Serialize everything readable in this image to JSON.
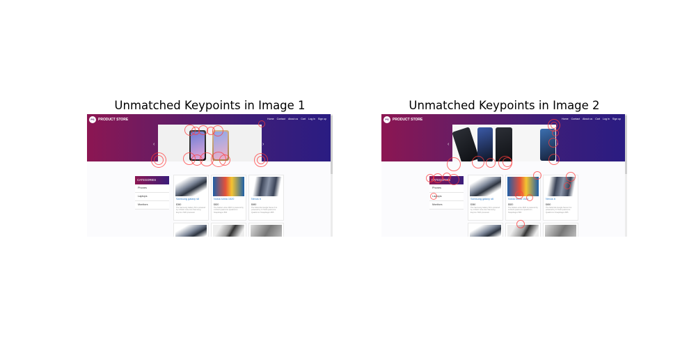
{
  "panels": [
    {
      "title": "Unmatched Keypoints in Image 1",
      "store": {
        "brand": "PRODUCT STORE",
        "logo_text": "PS",
        "nav": [
          "Home",
          "Contact",
          "About us",
          "Cart",
          "Log in",
          "Sign up"
        ],
        "categories_header": "CATEGORIES",
        "categories": [
          "Phones",
          "Laptops",
          "Monitors"
        ],
        "products": [
          {
            "name": "Samsung galaxy s6",
            "price": "$360",
            "desc": "The Samsung Galaxy S6 is powered by 1.5GHz octa-core Samsung Exynos 7420 processor"
          },
          {
            "name": "Nokia lumia 1520",
            "price": "$820",
            "desc": "The Nokia Lumia 1520 is powered by 2.2GHz quad-core Qualcomm Snapdragon 800"
          },
          {
            "name": "Nexus 6",
            "price": "$650",
            "desc": "The Motorola Google Nexus 6 is powered by 2.7GHz quad-core Qualcomm Snapdragon 805"
          }
        ]
      }
    },
    {
      "title": "Unmatched Keypoints in Image 2",
      "store": {
        "brand": "PRODUCT STORE",
        "logo_text": "PS",
        "nav": [
          "Home",
          "Contact",
          "About us",
          "Cart",
          "Log in",
          "Sign up"
        ],
        "categories_header": "CATEGORIES",
        "categories": [
          "Phones",
          "Laptops",
          "Monitors"
        ],
        "products": [
          {
            "name": "Samsung galaxy s6",
            "price": "$360",
            "desc": "The Samsung Galaxy S6 is powered by 1.5GHz octa-core Samsung Exynos 7420 processor"
          },
          {
            "name": "Nokia lumia 1520",
            "price": "$820",
            "desc": "The Nokia Lumia 1520 is powered by 2.2GHz quad-core Qualcomm Snapdragon 800"
          },
          {
            "name": "Nexus 6",
            "price": "$650",
            "desc": "The Motorola Google Nexus 6 is powered by 2.7GHz quad-core Qualcomm Snapdragon 805"
          }
        ]
      }
    }
  ],
  "colors": {
    "keypoint": "#ff3c3c",
    "hero_start": "#8c1652",
    "hero_end": "#2a1c82",
    "product_link": "#2a7ccb"
  },
  "icons": {
    "carousel_prev": "chevron-left-icon",
    "carousel_next": "chevron-right-icon"
  }
}
